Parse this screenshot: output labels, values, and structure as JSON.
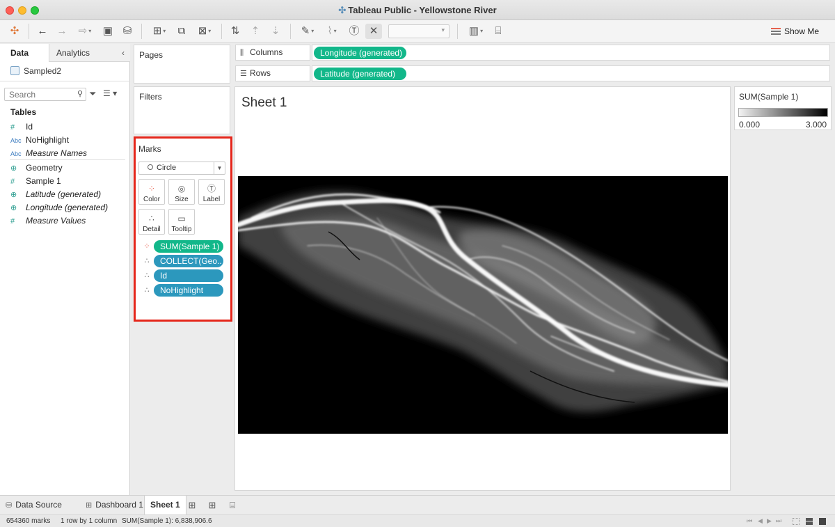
{
  "window": {
    "title": "Tableau Public - Yellowstone River"
  },
  "toolbar": {
    "show_me": "Show Me",
    "icons": [
      "tableau-logo-icon",
      "undo-icon",
      "redo-icon",
      "replay-icon",
      "save-icon",
      "new-datasource-icon",
      "new-worksheet-icon",
      "duplicate-sheet-icon",
      "clear-sheet-icon",
      "swap-rows-columns-icon",
      "sort-ascending-icon",
      "sort-descending-icon",
      "highlight-icon",
      "group-icon",
      "show-labels-icon",
      "fix-axes-icon",
      "fit-dropdown",
      "show-cards-icon",
      "presentation-icon"
    ]
  },
  "data_pane": {
    "tab_data": "Data",
    "tab_analytics": "Analytics",
    "collapse": "‹",
    "datasource": "Sampled2",
    "search_placeholder": "Search",
    "tables_header": "Tables",
    "fields": [
      {
        "icon": "#",
        "name": "Id",
        "italic": false
      },
      {
        "icon": "Abc",
        "name": "NoHighlight",
        "italic": false
      },
      {
        "icon": "Abc",
        "name": "Measure Names",
        "italic": true
      },
      {
        "icon": "⊕",
        "name": "Geometry",
        "italic": false
      },
      {
        "icon": "#",
        "name": "Sample 1",
        "italic": false
      },
      {
        "icon": "⊕",
        "name": "Latitude (generated)",
        "italic": true
      },
      {
        "icon": "⊕",
        "name": "Longitude (generated)",
        "italic": true
      },
      {
        "icon": "#",
        "name": "Measure Values",
        "italic": true
      }
    ]
  },
  "cards": {
    "pages": "Pages",
    "filters": "Filters",
    "marks": "Marks"
  },
  "shelves": {
    "columns_label": "Columns",
    "columns_pill": "Longitude (generated)",
    "rows_label": "Rows",
    "rows_pill": "Latitude (generated)"
  },
  "marks": {
    "mark_type": "Circle",
    "buttons": {
      "color": "Color",
      "size": "Size",
      "label": "Label",
      "detail": "Detail",
      "tooltip": "Tooltip"
    },
    "pills": [
      {
        "label": "SUM(Sample 1)",
        "kind": "color"
      },
      {
        "label": "COLLECT(Geo..",
        "kind": "detail"
      },
      {
        "label": "Id",
        "kind": "detail"
      },
      {
        "label": "NoHighlight",
        "kind": "detail"
      }
    ],
    "highlight_color": "#e5261b"
  },
  "sheet": {
    "title": "Sheet 1"
  },
  "legend": {
    "title": "SUM(Sample 1)",
    "min": "0.000",
    "max": "3.000"
  },
  "bottom_tabs": {
    "data_source": "Data Source",
    "dashboard": "Dashboard 1",
    "sheet": "Sheet 1"
  },
  "status": {
    "marks": "654360 marks",
    "rows_cols": "1 row by 1 column",
    "sum": "SUM(Sample 1): 6,838,906.6"
  },
  "colors": {
    "pill_green": "#12b78a",
    "pill_blue": "#2c98bd"
  }
}
